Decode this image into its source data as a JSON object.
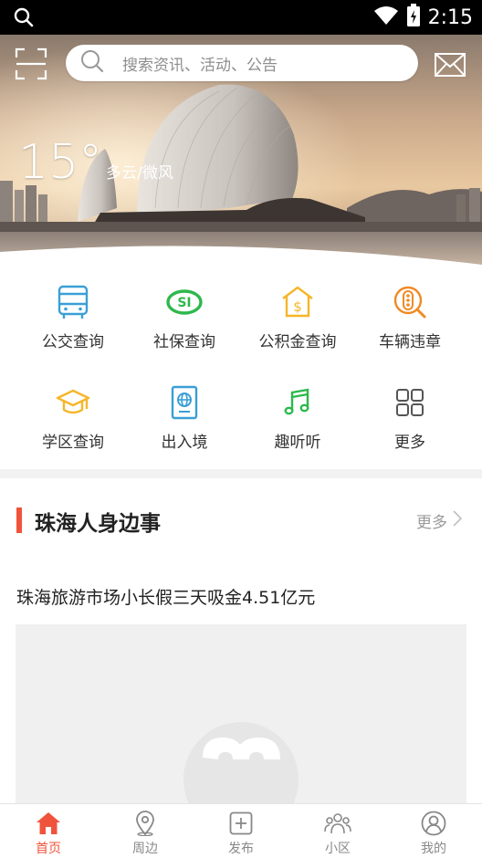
{
  "status_bar": {
    "time": "2:15"
  },
  "header": {
    "search_placeholder": "搜索资讯、活动、公告",
    "weather_temp": "15°",
    "weather_desc": "多云/微风"
  },
  "services": [
    {
      "label": "公交查询",
      "icon": "bus-icon"
    },
    {
      "label": "社保查询",
      "icon": "social-security-icon"
    },
    {
      "label": "公积金查询",
      "icon": "housing-fund-icon"
    },
    {
      "label": "车辆违章",
      "icon": "traffic-light-icon"
    },
    {
      "label": "学区查询",
      "icon": "graduation-cap-icon"
    },
    {
      "label": "出入境",
      "icon": "passport-icon"
    },
    {
      "label": "趣听听",
      "icon": "music-note-icon"
    },
    {
      "label": "更多",
      "icon": "grid-icon"
    }
  ],
  "section": {
    "title": "珠海人身边事",
    "more": "更多"
  },
  "news": [
    {
      "title": "珠海旅游市场小长假三天吸金4.51亿元"
    }
  ],
  "tabs": [
    {
      "label": "首页",
      "icon": "home-icon",
      "active": true
    },
    {
      "label": "周边",
      "icon": "location-pin-icon",
      "active": false
    },
    {
      "label": "发布",
      "icon": "plus-square-icon",
      "active": false
    },
    {
      "label": "小区",
      "icon": "community-icon",
      "active": false
    },
    {
      "label": "我的",
      "icon": "user-icon",
      "active": false
    }
  ],
  "colors": {
    "accent": "#f0533c",
    "service_blue": "#3a9fd6",
    "service_green": "#2db84d",
    "service_orange": "#f08a24",
    "service_yellow": "#f5b629"
  }
}
